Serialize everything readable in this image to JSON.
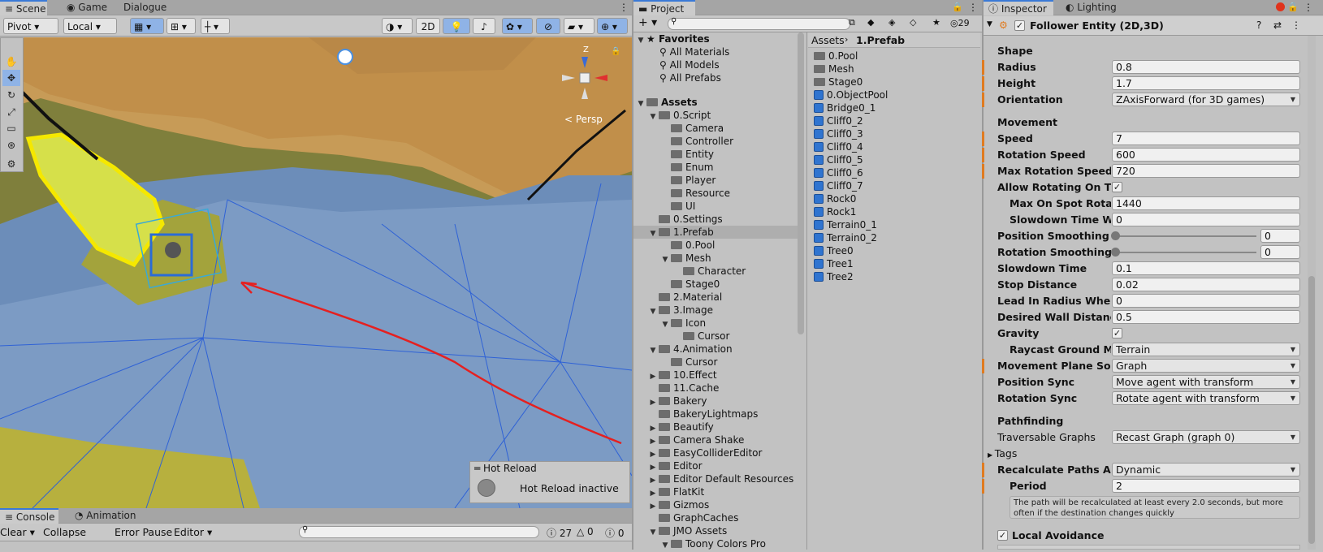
{
  "scene_panel": {
    "tabs": [
      "Scene",
      "Game",
      "Dialogue"
    ],
    "toolbar": {
      "pivot": "Pivot",
      "local": "Local",
      "mode2d": "2D"
    },
    "persp": "< Persp",
    "axis_z": "Z",
    "hot_reload": {
      "title": "Hot Reload",
      "status": "Hot Reload inactive"
    }
  },
  "console_panel": {
    "tabs": [
      "Console",
      "Animation"
    ],
    "clear": "Clear",
    "collapse": "Collapse",
    "error_pause": "Error Pause",
    "editor": "Editor",
    "counts": [
      "27",
      "0",
      "0"
    ]
  },
  "project_panel": {
    "tab": "Project",
    "hidden_count": "29",
    "favorites": {
      "label": "Favorites",
      "items": [
        "All Materials",
        "All Models",
        "All Prefabs"
      ]
    },
    "assets_label": "Assets",
    "tree": [
      {
        "label": "0.Script",
        "d": 1,
        "fold": "▼"
      },
      {
        "label": "Camera",
        "d": 2,
        "fold": ""
      },
      {
        "label": "Controller",
        "d": 2,
        "fold": ""
      },
      {
        "label": "Entity",
        "d": 2,
        "fold": ""
      },
      {
        "label": "Enum",
        "d": 2,
        "fold": ""
      },
      {
        "label": "Player",
        "d": 2,
        "fold": ""
      },
      {
        "label": "Resource",
        "d": 2,
        "fold": ""
      },
      {
        "label": "UI",
        "d": 2,
        "fold": ""
      },
      {
        "label": "0.Settings",
        "d": 1,
        "fold": ""
      },
      {
        "label": "1.Prefab",
        "d": 1,
        "fold": "▼",
        "sel": true
      },
      {
        "label": "0.Pool",
        "d": 2,
        "fold": ""
      },
      {
        "label": "Mesh",
        "d": 2,
        "fold": "▼"
      },
      {
        "label": "Character",
        "d": 3,
        "fold": ""
      },
      {
        "label": "Stage0",
        "d": 2,
        "fold": ""
      },
      {
        "label": "2.Material",
        "d": 1,
        "fold": ""
      },
      {
        "label": "3.Image",
        "d": 1,
        "fold": "▼"
      },
      {
        "label": "Icon",
        "d": 2,
        "fold": "▼"
      },
      {
        "label": "Cursor",
        "d": 3,
        "fold": ""
      },
      {
        "label": "4.Animation",
        "d": 1,
        "fold": "▼"
      },
      {
        "label": "Cursor",
        "d": 2,
        "fold": ""
      },
      {
        "label": "10.Effect",
        "d": 1,
        "fold": "▶"
      },
      {
        "label": "11.Cache",
        "d": 1,
        "fold": ""
      },
      {
        "label": "Bakery",
        "d": 1,
        "fold": "▶"
      },
      {
        "label": "BakeryLightmaps",
        "d": 1,
        "fold": ""
      },
      {
        "label": "Beautify",
        "d": 1,
        "fold": "▶"
      },
      {
        "label": "Camera Shake",
        "d": 1,
        "fold": "▶"
      },
      {
        "label": "EasyColliderEditor",
        "d": 1,
        "fold": "▶"
      },
      {
        "label": "Editor",
        "d": 1,
        "fold": "▶"
      },
      {
        "label": "Editor Default Resources",
        "d": 1,
        "fold": "▶"
      },
      {
        "label": "FlatKit",
        "d": 1,
        "fold": "▶"
      },
      {
        "label": "Gizmos",
        "d": 1,
        "fold": "▶"
      },
      {
        "label": "GraphCaches",
        "d": 1,
        "fold": ""
      },
      {
        "label": "JMO Assets",
        "d": 1,
        "fold": "▼"
      },
      {
        "label": "Toony Colors Pro",
        "d": 2,
        "fold": "▼"
      }
    ],
    "breadcrumb": [
      "Assets",
      "1.Prefab"
    ],
    "files": [
      {
        "label": "0.Pool",
        "t": "folder"
      },
      {
        "label": "Mesh",
        "t": "folder"
      },
      {
        "label": "Stage0",
        "t": "folder"
      },
      {
        "label": "0.ObjectPool",
        "t": "prefab"
      },
      {
        "label": "Bridge0_1",
        "t": "prefab"
      },
      {
        "label": "Cliff0_2",
        "t": "prefab"
      },
      {
        "label": "Cliff0_3",
        "t": "prefab"
      },
      {
        "label": "Cliff0_4",
        "t": "prefab"
      },
      {
        "label": "Cliff0_5",
        "t": "prefab"
      },
      {
        "label": "Cliff0_6",
        "t": "prefab"
      },
      {
        "label": "Cliff0_7",
        "t": "prefab"
      },
      {
        "label": "Rock0",
        "t": "prefab"
      },
      {
        "label": "Rock1",
        "t": "prefab"
      },
      {
        "label": "Terrain0_1",
        "t": "prefab"
      },
      {
        "label": "Terrain0_2",
        "t": "prefab"
      },
      {
        "label": "Tree0",
        "t": "prefab"
      },
      {
        "label": "Tree1",
        "t": "prefab"
      },
      {
        "label": "Tree2",
        "t": "prefab"
      }
    ]
  },
  "inspector": {
    "tabs": [
      "Inspector",
      "Lighting"
    ],
    "component": "Follower Entity (2D,3D)",
    "shape": "Shape",
    "radius": {
      "label": "Radius",
      "value": "0.8"
    },
    "height": {
      "label": "Height",
      "value": "1.7"
    },
    "orientation": {
      "label": "Orientation",
      "value": "ZAxisForward (for 3D games)"
    },
    "movement": "Movement",
    "speed": {
      "label": "Speed",
      "value": "7"
    },
    "rot_speed": {
      "label": "Rotation Speed",
      "value": "600"
    },
    "max_rot_speed": {
      "label": "Max Rotation Speed",
      "value": "720"
    },
    "allow_rot": {
      "label": "Allow Rotating On The S",
      "checked": true
    },
    "max_on_spot": {
      "label": "Max On Spot Rotatior",
      "value": "1440"
    },
    "slowdown_when": {
      "label": "Slowdown Time Wher",
      "value": "0"
    },
    "pos_smooth": {
      "label": "Position Smoothing",
      "value": "0",
      "fraction": 0
    },
    "rot_smooth": {
      "label": "Rotation Smoothing",
      "value": "0",
      "fraction": 0
    },
    "slowdown": {
      "label": "Slowdown Time",
      "value": "0.1"
    },
    "stop_dist": {
      "label": "Stop Distance",
      "value": "0.02"
    },
    "lead_in": {
      "label": "Lead In Radius When Ap",
      "value": "0"
    },
    "wall_dist": {
      "label": "Desired Wall Distance",
      "value": "0.5"
    },
    "gravity": {
      "label": "Gravity",
      "checked": true
    },
    "raycast": {
      "label": "Raycast Ground Mas",
      "value": "Terrain"
    },
    "plane_src": {
      "label": "Movement Plane Source",
      "value": "Graph"
    },
    "pos_sync": {
      "label": "Position Sync",
      "value": "Move agent with transform"
    },
    "rot_sync": {
      "label": "Rotation Sync",
      "value": "Rotate agent with transform"
    },
    "pathfinding": "Pathfinding",
    "graphs": {
      "label": "Traversable Graphs",
      "value": "Recast Graph (graph 0)"
    },
    "tags": "Tags",
    "recalc": {
      "label": "Recalculate Paths Autor",
      "value": "Dynamic"
    },
    "period": {
      "label": "Period",
      "value": "2"
    },
    "help": "The path will be recalculated at least every 2.0 seconds, but more often if the destination changes quickly",
    "local_avoid": "Local Avoidance"
  }
}
